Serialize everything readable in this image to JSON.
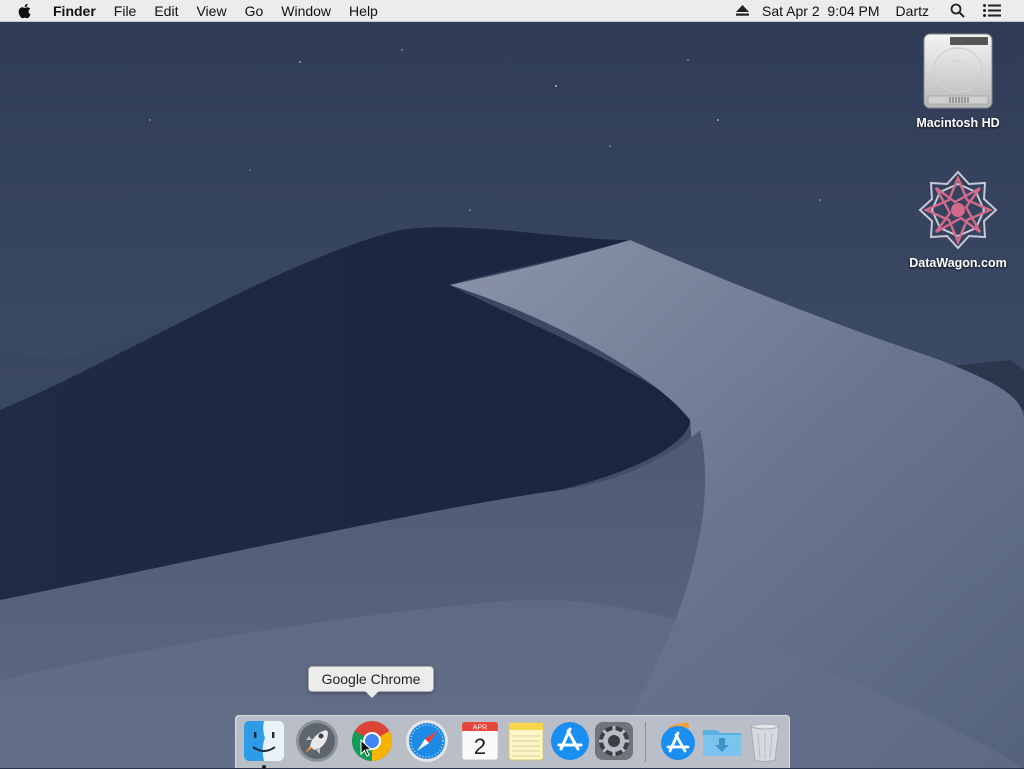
{
  "menubar": {
    "app_name": "Finder",
    "menus": [
      "File",
      "Edit",
      "View",
      "Go",
      "Window",
      "Help"
    ],
    "datetime": "Sat Apr 2  9:04 PM",
    "user": "Dartz"
  },
  "desktop": {
    "icons": [
      {
        "label": "Macintosh HD",
        "icon": "hard-drive-icon"
      },
      {
        "label": "DataWagon.com",
        "icon": "datawagon-logo-icon"
      }
    ]
  },
  "tooltip": {
    "text": "Google Chrome"
  },
  "dock": {
    "calendar": {
      "month": "APR",
      "day": "2"
    },
    "apps": [
      {
        "name": "finder",
        "icon": "finder-icon",
        "running": true
      },
      {
        "name": "launchpad",
        "icon": "launchpad-rocket-icon",
        "running": false
      },
      {
        "name": "google-chrome",
        "icon": "chrome-icon",
        "running": false
      },
      {
        "name": "safari",
        "icon": "safari-compass-icon",
        "running": false
      },
      {
        "name": "calendar",
        "icon": "calendar-icon",
        "running": false
      },
      {
        "name": "notes",
        "icon": "notes-icon",
        "running": false
      },
      {
        "name": "app-store",
        "icon": "app-store-icon",
        "running": false
      },
      {
        "name": "system-preferences",
        "icon": "gear-icon",
        "running": false
      },
      {
        "name": "applications-stack",
        "icon": "app-store-stack-icon",
        "running": false
      },
      {
        "name": "downloads-stack",
        "icon": "downloads-folder-icon",
        "running": false
      },
      {
        "name": "trash",
        "icon": "trash-icon",
        "running": false
      }
    ]
  },
  "colors": {
    "menubar_bg": "#ececec",
    "chrome_red": "#db4437",
    "chrome_green": "#0f9d58",
    "chrome_yellow": "#f4b400",
    "chrome_blue": "#4285f4"
  }
}
